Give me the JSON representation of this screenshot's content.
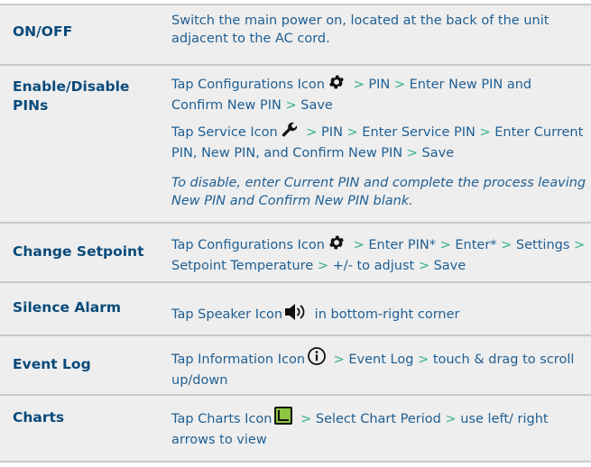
{
  "colors": {
    "row_bg": "#eeeeee",
    "label": "#0a4a7a",
    "text": "#1f5f93",
    "separator": "#2fb08a",
    "border": "#c9c9c9"
  },
  "rows": [
    {
      "label": "ON/OFF",
      "text": "Switch the main power on, located at the back of the unit adjacent to the AC cord."
    },
    {
      "label": "Enable/Disable PINs",
      "lines": [
        {
          "pre": "Tap Configurations Icon",
          "icon": "gear-icon",
          "post": [
            "PIN",
            "Enter New PIN and Confirm New PIN",
            "Save"
          ]
        },
        {
          "pre": "Tap Service Icon",
          "icon": "wrench-icon",
          "post": [
            "PIN",
            "Enter Service PIN",
            "Enter Current PIN, New PIN, and Confirm New PIN",
            "Save"
          ]
        }
      ],
      "note": "To disable, enter Current PIN and complete the process leaving New PIN and Confirm New PIN blank."
    },
    {
      "label": "Change Setpoint",
      "pre": "Tap Configurations Icon",
      "icon": "gear-icon",
      "post": [
        "Enter PIN*",
        "Enter*",
        "Settings",
        "Setpoint Temperature",
        "+/- to adjust",
        "Save"
      ]
    },
    {
      "label": "Silence Alarm",
      "pre": "Tap Speaker Icon",
      "icon": "speaker-icon",
      "post_text": "in bottom-right corner"
    },
    {
      "label": "Event Log",
      "pre": "Tap Information Icon",
      "icon": "info-icon",
      "post": [
        "Event Log",
        "touch & drag to scroll up/down"
      ]
    },
    {
      "label": "Charts",
      "pre": "Tap Charts Icon",
      "icon": "chart-icon",
      "post": [
        "Select Chart Period",
        "use left/ right arrows to view"
      ]
    }
  ],
  "separator": ">"
}
